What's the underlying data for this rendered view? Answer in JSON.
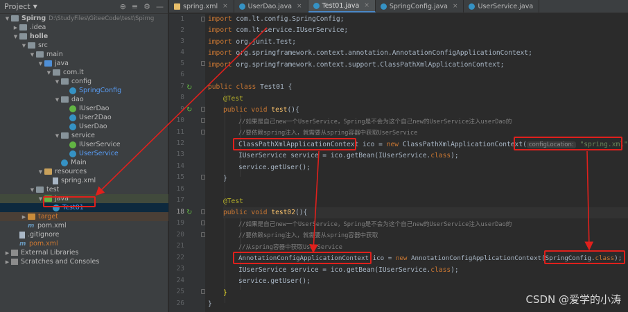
{
  "project_panel": {
    "title": "Project",
    "tree": [
      {
        "label": "Spirng",
        "path": "D:\\StudyFiles\\GiteeCode\\test\\Spirng",
        "bold": true
      },
      {
        "label": ".idea"
      },
      {
        "label": "holle",
        "bold": true
      },
      {
        "label": "src"
      },
      {
        "label": "main"
      },
      {
        "label": "java"
      },
      {
        "label": "com.lt"
      },
      {
        "label": "config"
      },
      {
        "label": "SpringConfig"
      },
      {
        "label": "dao"
      },
      {
        "label": "IUserDao"
      },
      {
        "label": "User2Dao"
      },
      {
        "label": "UserDao"
      },
      {
        "label": "service"
      },
      {
        "label": "IUserService"
      },
      {
        "label": "UserService"
      },
      {
        "label": "Main"
      },
      {
        "label": "resources"
      },
      {
        "label": "spring.xml"
      },
      {
        "label": "test"
      },
      {
        "label": "java"
      },
      {
        "label": "Test01"
      },
      {
        "label": "target"
      },
      {
        "label": "pom.xml"
      },
      {
        "label": ".gitignore"
      },
      {
        "label": "pom.xml"
      },
      {
        "label": "External Libraries"
      },
      {
        "label": "Scratches and Consoles"
      }
    ]
  },
  "tabs": [
    {
      "label": "spring.xml"
    },
    {
      "label": "UserDao.java"
    },
    {
      "label": "Test01.java"
    },
    {
      "label": "SpringConfig.java"
    },
    {
      "label": "UserService.java"
    }
  ],
  "line_numbers": [
    "1",
    "2",
    "3",
    "4",
    "5",
    "6",
    "7",
    "8",
    "9",
    "10",
    "11",
    "12",
    "13",
    "14",
    "15",
    "16",
    "17",
    "18",
    "19",
    "20",
    "21",
    "22",
    "23",
    "24",
    "25",
    "26"
  ],
  "code": {
    "l1_kw": "import",
    "l1_rest": " com.lt.config.SpringConfig;",
    "l2_kw": "import",
    "l2_rest": " com.lt.service.IUserService;",
    "l3_kw": "import",
    "l3_rest": " org.junit.Test;",
    "l4_kw": "import",
    "l4_rest": " org.springframework.context.annotation.AnnotationConfigApplicationContext;",
    "l5_kw": "import",
    "l5_rest": " org.springframework.context.support.ClassPathXmlApplicationContext;",
    "l7_kw": "public class",
    "l7_rest": " Test01 {",
    "l8_ann": "@Test",
    "l9_kw": "public void",
    "l9_fn": " test",
    "l9_rest": "(){",
    "l10_cmt": "//如果是自己new一个UserService，Spring是不会为这个自己new的UserService注入userDao的",
    "l11_cmt": "//要依赖spring注入，就需要从spring容器中获取UserService",
    "l12_a": "ClassPathXmlApplicationContext",
    "l12_b": " ico = ",
    "l12_kw": "new",
    "l12_c": " ClassPathXmlApplicationContext(",
    "l12_hint": "configLocation:",
    "l12_str": " \"spring.xml\"",
    "l12_d": ");",
    "l13_a": "IUserService service = ico.getBean(IUserService.",
    "l13_kw": "class",
    "l13_b": ");",
    "l14": "service.getUser();",
    "l15": "}",
    "l17_ann": "@Test",
    "l18_kw": "public void",
    "l18_fn": " test02",
    "l18_rest": "(){",
    "l19_cmt": "//如果是自己new一个UserService，Spring是不会为这个自己new的UserService注入userDao的",
    "l20_cmt": "//要依赖spring注入，就需要从spring容器中获取",
    "l21_cmt": "//从spring容器中获取UserService",
    "l22_a": "AnnotationConfigApplicationContext",
    "l22_b": " ico = ",
    "l22_kw": "new",
    "l22_c": " AnnotationConfigApplicationContext(",
    "l22_d": "SpringConfig.",
    "l22_kw2": "class",
    "l22_e": ");",
    "l23_a": "IUserService service = ico.getBean(IUserService.",
    "l23_kw": "class",
    "l23_b": ");",
    "l24": "service.getUser();",
    "l25": "}",
    "l26": "}"
  },
  "watermark": "CSDN @爱学的小涛",
  "colors": {
    "annotation_red": "#e0201c",
    "keyword": "#cc7832",
    "comment": "#808080",
    "string": "#6a8759"
  }
}
